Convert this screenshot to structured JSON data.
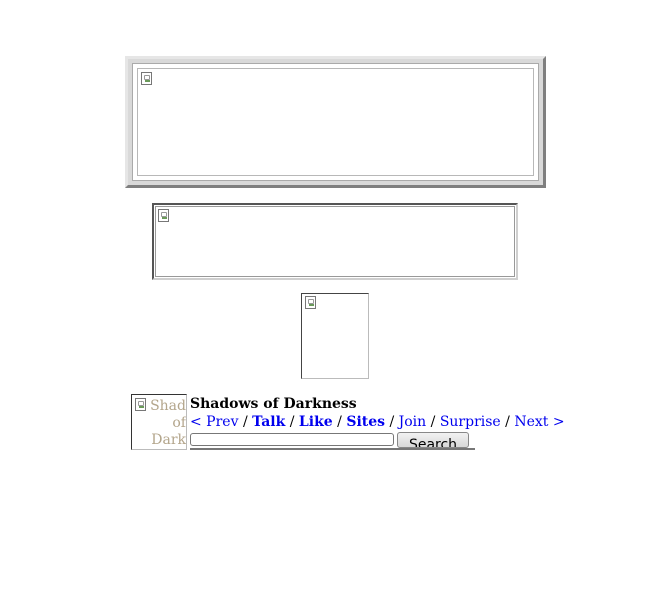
{
  "banner": {
    "image_icon": "broken-image-icon"
  },
  "ad": {
    "image_icon": "broken-image-icon"
  },
  "square_ad": {
    "image_icon": "broken-image-icon"
  },
  "ring": {
    "logo_alt": "Shad\nof\nDark",
    "title": "Shadows of Darkness",
    "nav": {
      "prev": "< Prev",
      "talk": "Talk",
      "like": "Like",
      "sites": "Sites",
      "join": "Join",
      "surprise": "Surprise",
      "next": "Next >",
      "separator": "/"
    },
    "search": {
      "input_value": "",
      "button_label": "Search"
    }
  },
  "colors": {
    "link": "#0000ee",
    "logo_alt_text": "#b3a58b"
  }
}
